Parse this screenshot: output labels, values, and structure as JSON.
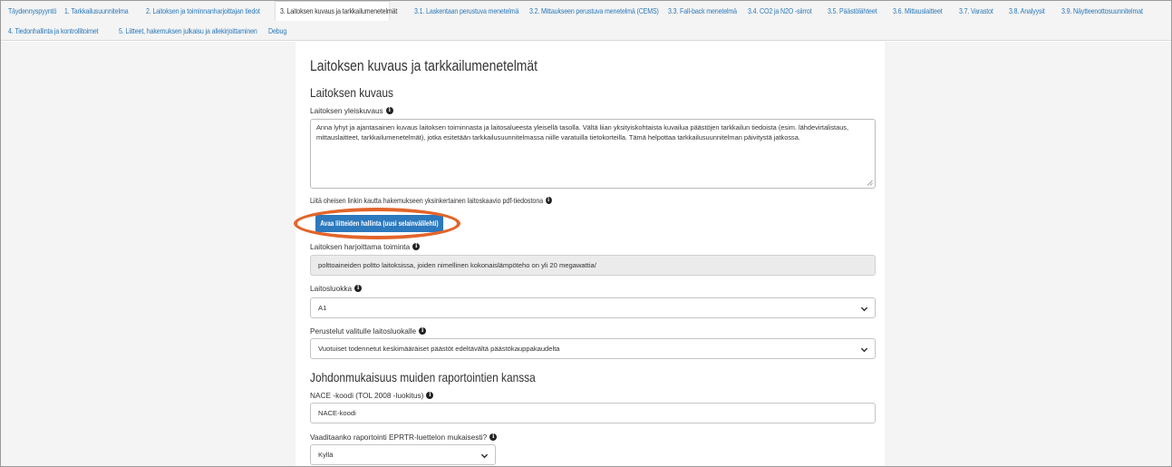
{
  "nav": {
    "row1": [
      "Täydennyspyyntö",
      "1. Tarkkailusuunnitelma",
      "2. Laitoksen ja toiminnanharjoittajan tiedot",
      "3. Laitoksen kuvaus ja tarkkailumenetelmät",
      "3.1. Laskentaan perustuva menetelmä",
      "3.2. Mittaukseen perustuva menetelmä (CEMS)",
      "3.3. Fall-back menetelmä",
      "3.4. CO2 ja N2O -siirrot",
      "3.5. Päästölähteet",
      "3.6. Mittauslaitteet",
      "3.7. Varastot",
      "3.8. Analyysit",
      "3.9. Näytteenottosuunnitelmat"
    ],
    "row2": [
      "4. Tiedonhallinta ja kontrollitoimet",
      "5. Liitteet, hakemuksen julkaisu ja allekirjoittaminen",
      "Debug"
    ],
    "active_index": 3
  },
  "page": {
    "title": "Laitoksen kuvaus ja tarkkailumenetelmät",
    "section1_title": "Laitoksen kuvaus",
    "general_label": "Laitoksen yleiskuvaus",
    "general_text": "Anna lyhyt ja ajantasainen kuvaus laitoksen toiminnasta ja laitosalueesta yleisellä tasolla. Vältä liian yksityiskohtaista kuvailua päästöjen tarkkailun tiedoista (esim. lähdevirtalistaus, mittauslaitteet, tarkkailumenetelmät), jotka esitetään tarkkailusuunnitelmassa niille varatuilla tietokorteilla. Tämä helpottaa tarkkailusuunnitelman päivitystä jatkossa.",
    "attach_label": "Liitä oheisen linkin kautta hakemukseen yksinkertainen laitoskaavio pdf-tiedostona",
    "attach_button": "Avaa liitteiden hallinta (uusi selainvälilehti)",
    "activity_label": "Laitoksen harjoittama toiminta",
    "activity_value": "polttoaineiden poltto laitoksissa, joiden nimellinen kokonaislämpöteho on yli 20 megawattia/",
    "category_label": "Laitosluokka",
    "category_value": "A1",
    "justification_label": "Perustelut valitulle laitosluokalle",
    "justification_value": "Vuotuiset todennetut keskimääräiset päästöt edeltävältä päästökauppakaudelta",
    "section2_title": "Johdonmukaisuus muiden raportointien kanssa",
    "nace_label": "NACE -koodi (TOL 2008 -luokitus)",
    "nace_value": "NACE-koodi",
    "eprtr_label": "Vaaditaanko raportointi EPRTR-luettelon mukaisesti?",
    "eprtr_value": "Kyllä"
  },
  "colors": {
    "link": "#2b78b8",
    "button": "#2c79bd",
    "highlight": "#e2652a"
  }
}
